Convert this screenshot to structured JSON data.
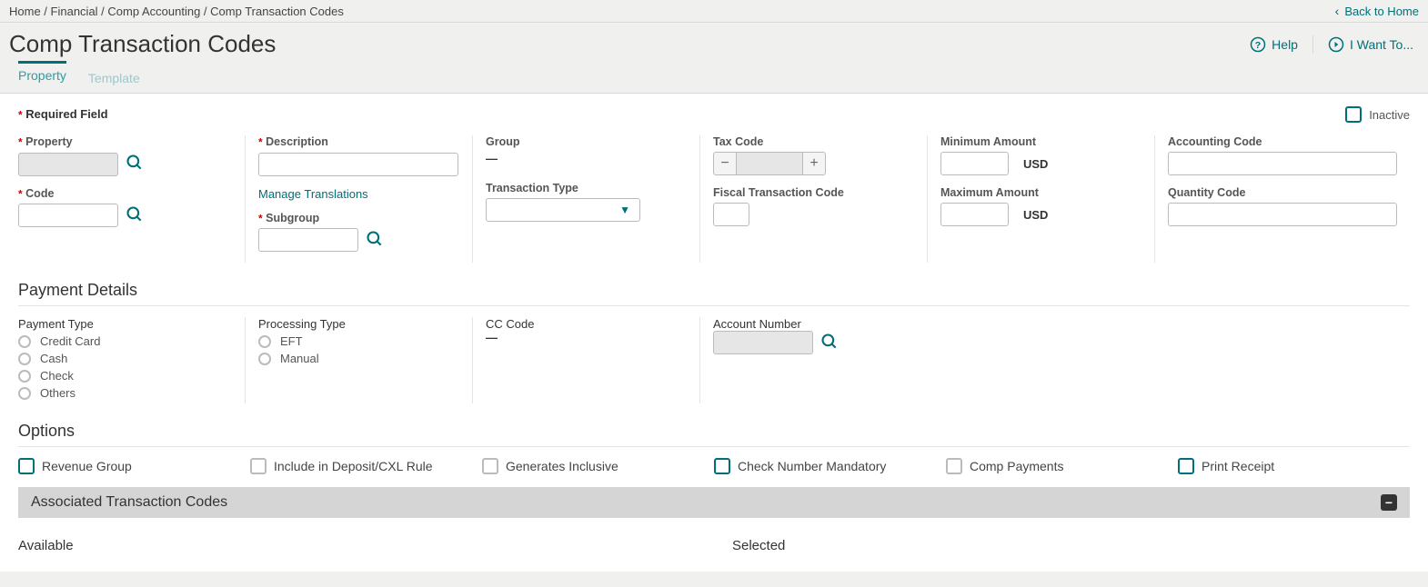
{
  "breadcrumb": {
    "home": "Home",
    "financial": "Financial",
    "compacct": "Comp Accounting",
    "page": "Comp Transaction Codes",
    "back": "Back to Home"
  },
  "title": "Comp Transaction Codes",
  "actions": {
    "help": "Help",
    "iwantto": "I Want To..."
  },
  "tabs": {
    "property": "Property",
    "template": "Template"
  },
  "required_label": "Required Field",
  "inactive_label": "Inactive",
  "fields": {
    "property": "Property",
    "code": "Code",
    "description": "Description",
    "manage_translations": "Manage Translations",
    "subgroup": "Subgroup",
    "group": "Group",
    "transaction_type": "Transaction Type",
    "tax_code": "Tax Code",
    "fiscal_trx": "Fiscal Transaction Code",
    "min_amount": "Minimum Amount",
    "max_amount": "Maximum Amount",
    "currency": "USD",
    "accounting_code": "Accounting Code",
    "quantity_code": "Quantity Code"
  },
  "payment": {
    "section": "Payment Details",
    "payment_type": "Payment Type",
    "opt_credit": "Credit Card",
    "opt_cash": "Cash",
    "opt_check": "Check",
    "opt_others": "Others",
    "processing_type": "Processing Type",
    "opt_eft": "EFT",
    "opt_manual": "Manual",
    "cc_code": "CC Code",
    "account_number": "Account Number"
  },
  "options": {
    "section": "Options",
    "revenue_group": "Revenue Group",
    "include_deposit": "Include in Deposit/CXL Rule",
    "generates_inclusive": "Generates Inclusive",
    "check_number_mandatory": "Check Number Mandatory",
    "comp_payments": "Comp Payments",
    "print_receipt": "Print Receipt"
  },
  "assoc": {
    "title": "Associated Transaction Codes",
    "available": "Available",
    "selected": "Selected"
  },
  "icons": {
    "dash": "—",
    "minus": "−",
    "plus": "+",
    "caret": "▼",
    "chev": "‹",
    "collapse": "−"
  }
}
